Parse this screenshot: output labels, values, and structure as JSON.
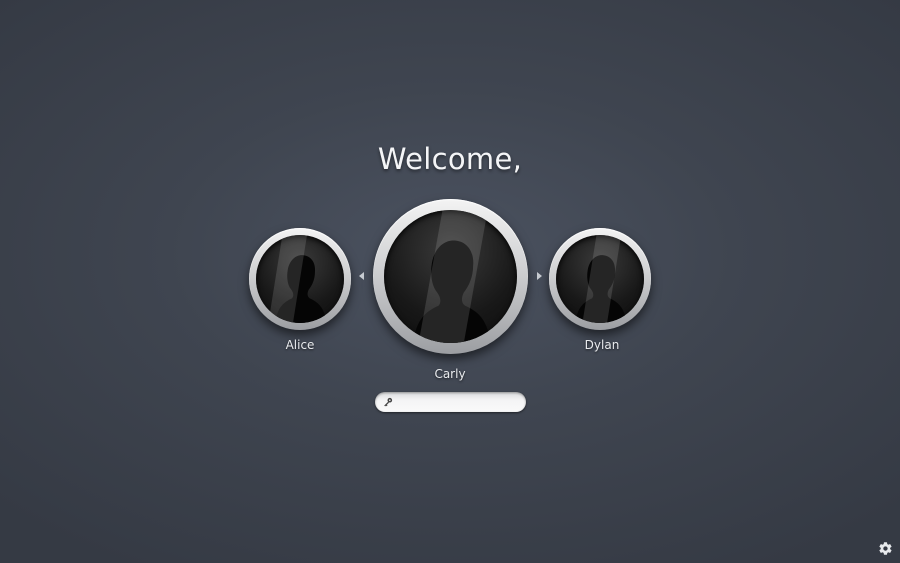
{
  "welcome_text": "Welcome,",
  "users": [
    {
      "name": "Alice",
      "selected": false,
      "icon": "user-silhouette-icon"
    },
    {
      "name": "Carly",
      "selected": true,
      "icon": "user-silhouette-icon"
    },
    {
      "name": "Dylan",
      "selected": false,
      "icon": "user-silhouette-icon"
    }
  ],
  "password_field": {
    "value": "",
    "placeholder": "",
    "icon": "key-icon"
  },
  "navigation": {
    "previous_icon": "arrow-left-icon",
    "next_icon": "arrow-right-icon"
  },
  "settings_icon": "gear-icon",
  "colors": {
    "background": "#3f4550",
    "text": "#f4f5f7",
    "ring": "#d4d5d7",
    "avatar": "#111111"
  }
}
